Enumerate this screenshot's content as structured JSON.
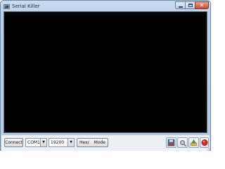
{
  "window": {
    "title": "Serial Killer",
    "icon": "serial-killer-app-icon",
    "controls": {
      "minimize_icon": "minimize-icon",
      "maximize_icon": "maximize-icon",
      "close_icon": "close-icon",
      "close_glyph": "✕"
    }
  },
  "terminal": {
    "background": "#000000",
    "text": ""
  },
  "statusbar": {
    "connect_label": "Connect",
    "port": {
      "selected": "COM1"
    },
    "baud": {
      "selected": "19200"
    },
    "mode_prefix": "Hex/",
    "mode_label": "Mode",
    "tools": [
      {
        "name": "save-icon"
      },
      {
        "name": "settings-icon"
      },
      {
        "name": "clear-icon"
      },
      {
        "name": "stop-icon"
      }
    ]
  },
  "colors": {
    "titlebar": "#b9d0e8",
    "close_button": "#c94a2e",
    "stop": "#d12a1f",
    "terminal": "#000000"
  }
}
